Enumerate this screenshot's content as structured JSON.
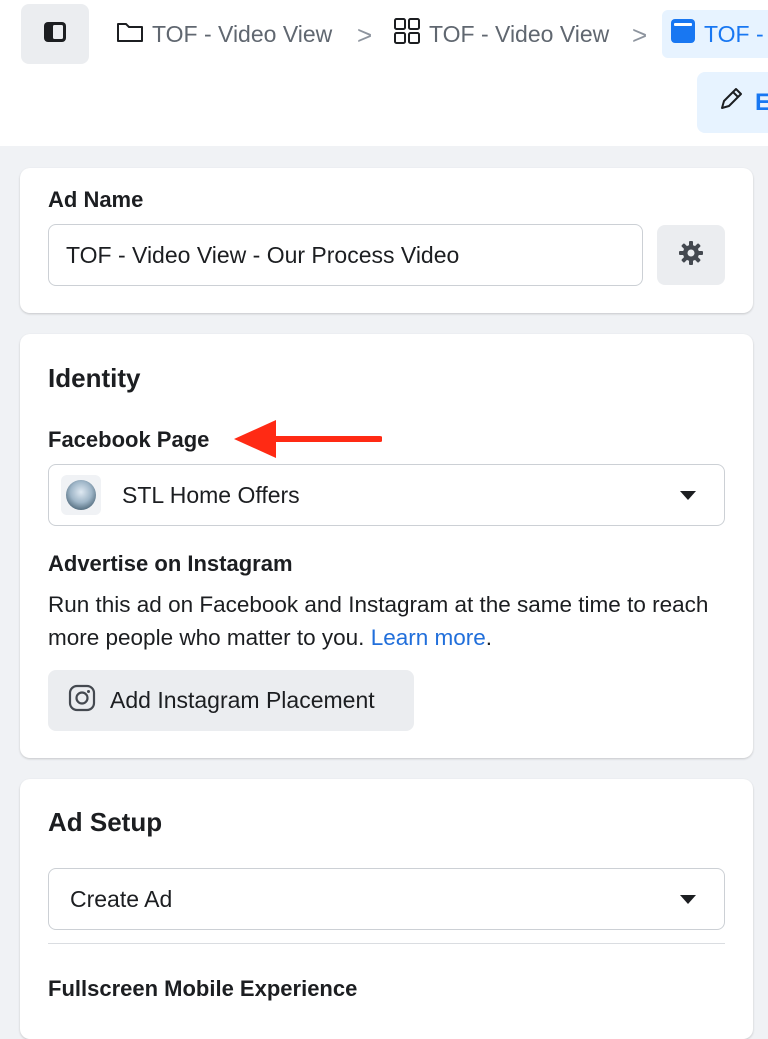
{
  "header": {
    "breadcrumbs": [
      {
        "label": "TOF - Video View",
        "icon": "folder-icon"
      },
      {
        "label": "TOF - Video View",
        "icon": "grid-icon"
      },
      {
        "label": "TOF - V",
        "icon": "ad-icon"
      }
    ],
    "separator": ">",
    "edit_label": "E"
  },
  "ad_name": {
    "label": "Ad Name",
    "value": "TOF - Video View - Our Process Video"
  },
  "identity": {
    "title": "Identity",
    "facebook_page_label": "Facebook Page",
    "facebook_page_value": "STL Home Offers",
    "instagram_label": "Advertise on Instagram",
    "instagram_description": "Run this ad on Facebook and Instagram at the same time to reach more people who matter to you.",
    "learn_more": "Learn more",
    "learn_more_suffix": ".",
    "add_instagram_button": "Add Instagram Placement"
  },
  "ad_setup": {
    "title": "Ad Setup",
    "selected_option": "Create Ad",
    "fullscreen_label": "Fullscreen Mobile Experience"
  },
  "colors": {
    "accent": "#1877f2",
    "link": "#216fdb",
    "annotation_arrow": "#ff2a14",
    "page_background": "#f0f2f5"
  }
}
